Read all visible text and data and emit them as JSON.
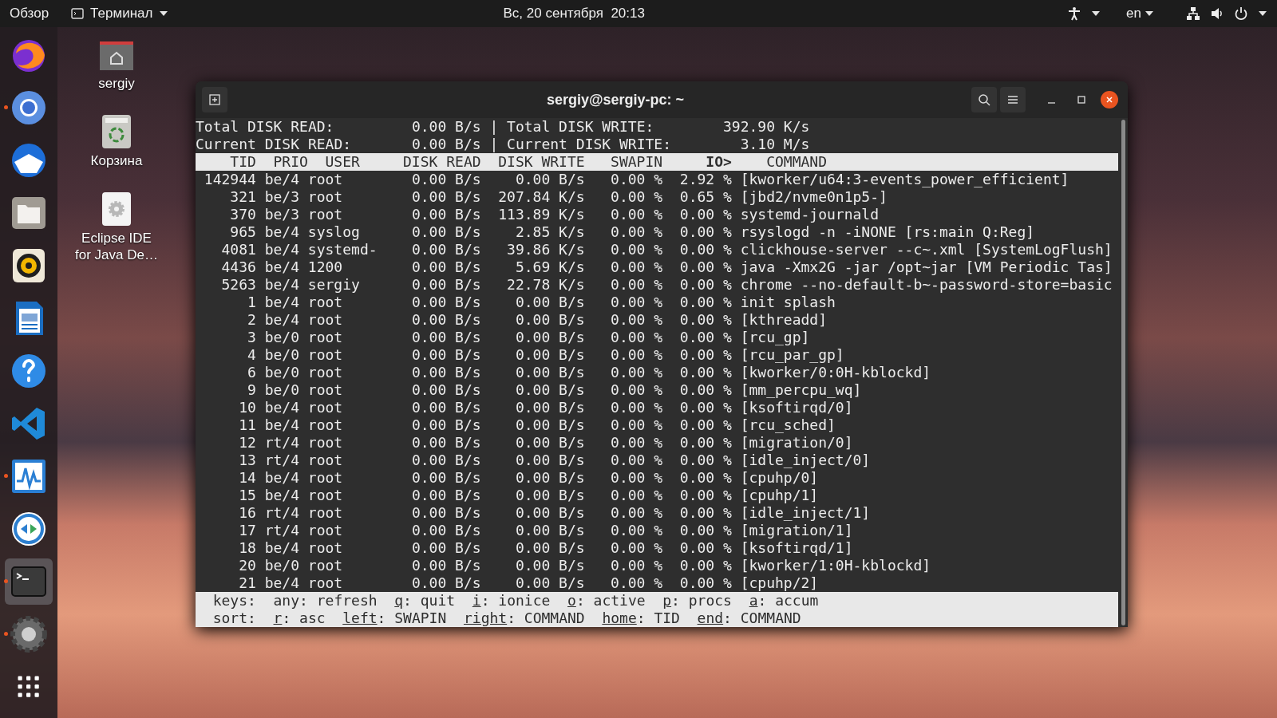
{
  "top_bar": {
    "overview": "Обзор",
    "app_menu": "Терминал",
    "clock": "Вс, 20 сентября  20:13",
    "language": "en"
  },
  "dock": [
    {
      "running": false,
      "active": false
    },
    {
      "running": true,
      "active": false
    },
    {
      "running": false,
      "active": false
    },
    {
      "running": false,
      "active": false
    },
    {
      "running": false,
      "active": false
    },
    {
      "running": false,
      "active": false
    },
    {
      "running": false,
      "active": false
    },
    {
      "running": false,
      "active": false
    },
    {
      "running": true,
      "active": false
    },
    {
      "running": false,
      "active": false
    },
    {
      "running": true,
      "active": true
    },
    {
      "running": true,
      "active": false
    },
    {
      "running": false,
      "active": false
    }
  ],
  "desktop_icons": [
    {
      "kind": "folder",
      "label": "sergiy"
    },
    {
      "kind": "trash",
      "label": "Корзина"
    },
    {
      "kind": "app",
      "label": "Eclipse IDE for Java De…"
    }
  ],
  "terminal": {
    "title": "sergiy@sergiy-pc: ~",
    "summary": [
      {
        "label": "Total DISK READ:",
        "value": "0.00 B/s",
        "separator": "|",
        "label2": "Total DISK WRITE:",
        "value2": "392.90 K/s"
      },
      {
        "label": "Current DISK READ:",
        "value": "0.00 B/s",
        "separator": "|",
        "label2": "Current DISK WRITE:",
        "value2": "3.10 M/s"
      }
    ],
    "columns": [
      {
        "label": "TID",
        "sorted": false
      },
      {
        "label": "PRIO",
        "sorted": false
      },
      {
        "label": "USER",
        "sorted": false
      },
      {
        "label": "DISK READ",
        "sorted": false
      },
      {
        "label": "DISK WRITE",
        "sorted": false
      },
      {
        "label": "SWAPIN",
        "sorted": false
      },
      {
        "label": "IO>",
        "sorted": true
      },
      {
        "label": "COMMAND",
        "sorted": false
      }
    ],
    "rows": [
      [
        "142944",
        "be/4",
        "root",
        "0.00 B/s",
        "0.00 B/s",
        "0.00 %",
        "2.92 %",
        "[kworker/u64:3-events_power_efficient]"
      ],
      [
        "321",
        "be/3",
        "root",
        "0.00 B/s",
        "207.84 K/s",
        "0.00 %",
        "0.65 %",
        "[jbd2/nvme0n1p5-]"
      ],
      [
        "370",
        "be/3",
        "root",
        "0.00 B/s",
        "113.89 K/s",
        "0.00 %",
        "0.00 %",
        "systemd-journald"
      ],
      [
        "965",
        "be/4",
        "syslog",
        "0.00 B/s",
        "2.85 K/s",
        "0.00 %",
        "0.00 %",
        "rsyslogd -n -iNONE [rs:main Q:Reg]"
      ],
      [
        "4081",
        "be/4",
        "systemd-",
        "0.00 B/s",
        "39.86 K/s",
        "0.00 %",
        "0.00 %",
        "clickhouse-server --c~.xml [SystemLogFlush]"
      ],
      [
        "4436",
        "be/4",
        "1200",
        "0.00 B/s",
        "5.69 K/s",
        "0.00 %",
        "0.00 %",
        "java -Xmx2G -jar /opt~jar [VM Periodic Tas]"
      ],
      [
        "5263",
        "be/4",
        "sergiy",
        "0.00 B/s",
        "22.78 K/s",
        "0.00 %",
        "0.00 %",
        "chrome --no-default-b~-password-store=basic"
      ],
      [
        "1",
        "be/4",
        "root",
        "0.00 B/s",
        "0.00 B/s",
        "0.00 %",
        "0.00 %",
        "init splash"
      ],
      [
        "2",
        "be/4",
        "root",
        "0.00 B/s",
        "0.00 B/s",
        "0.00 %",
        "0.00 %",
        "[kthreadd]"
      ],
      [
        "3",
        "be/0",
        "root",
        "0.00 B/s",
        "0.00 B/s",
        "0.00 %",
        "0.00 %",
        "[rcu_gp]"
      ],
      [
        "4",
        "be/0",
        "root",
        "0.00 B/s",
        "0.00 B/s",
        "0.00 %",
        "0.00 %",
        "[rcu_par_gp]"
      ],
      [
        "6",
        "be/0",
        "root",
        "0.00 B/s",
        "0.00 B/s",
        "0.00 %",
        "0.00 %",
        "[kworker/0:0H-kblockd]"
      ],
      [
        "9",
        "be/0",
        "root",
        "0.00 B/s",
        "0.00 B/s",
        "0.00 %",
        "0.00 %",
        "[mm_percpu_wq]"
      ],
      [
        "10",
        "be/4",
        "root",
        "0.00 B/s",
        "0.00 B/s",
        "0.00 %",
        "0.00 %",
        "[ksoftirqd/0]"
      ],
      [
        "11",
        "be/4",
        "root",
        "0.00 B/s",
        "0.00 B/s",
        "0.00 %",
        "0.00 %",
        "[rcu_sched]"
      ],
      [
        "12",
        "rt/4",
        "root",
        "0.00 B/s",
        "0.00 B/s",
        "0.00 %",
        "0.00 %",
        "[migration/0]"
      ],
      [
        "13",
        "rt/4",
        "root",
        "0.00 B/s",
        "0.00 B/s",
        "0.00 %",
        "0.00 %",
        "[idle_inject/0]"
      ],
      [
        "14",
        "be/4",
        "root",
        "0.00 B/s",
        "0.00 B/s",
        "0.00 %",
        "0.00 %",
        "[cpuhp/0]"
      ],
      [
        "15",
        "be/4",
        "root",
        "0.00 B/s",
        "0.00 B/s",
        "0.00 %",
        "0.00 %",
        "[cpuhp/1]"
      ],
      [
        "16",
        "rt/4",
        "root",
        "0.00 B/s",
        "0.00 B/s",
        "0.00 %",
        "0.00 %",
        "[idle_inject/1]"
      ],
      [
        "17",
        "rt/4",
        "root",
        "0.00 B/s",
        "0.00 B/s",
        "0.00 %",
        "0.00 %",
        "[migration/1]"
      ],
      [
        "18",
        "be/4",
        "root",
        "0.00 B/s",
        "0.00 B/s",
        "0.00 %",
        "0.00 %",
        "[ksoftirqd/1]"
      ],
      [
        "20",
        "be/0",
        "root",
        "0.00 B/s",
        "0.00 B/s",
        "0.00 %",
        "0.00 %",
        "[kworker/1:0H-kblockd]"
      ],
      [
        "21",
        "be/4",
        "root",
        "0.00 B/s",
        "0.00 B/s",
        "0.00 %",
        "0.00 %",
        "[cpuhp/2]"
      ]
    ],
    "key_lines": [
      {
        "label": "keys:",
        "items": [
          {
            "key": "any",
            "text": ": refresh",
            "underlined": false
          },
          {
            "key": "q",
            "text": ": quit",
            "underlined": true
          },
          {
            "key": "i",
            "text": ": ionice",
            "underlined": true
          },
          {
            "key": "o",
            "text": ": active",
            "underlined": true
          },
          {
            "key": "p",
            "text": ": procs",
            "underlined": true
          },
          {
            "key": "a",
            "text": ": accum",
            "underlined": true
          }
        ]
      },
      {
        "label": "sort:",
        "items": [
          {
            "key": "r",
            "text": ": asc",
            "underlined": true
          },
          {
            "key": "left",
            "text": ": SWAPIN",
            "underlined": true
          },
          {
            "key": "right",
            "text": ": COMMAND",
            "underlined": true
          },
          {
            "key": "home",
            "text": ": TID",
            "underlined": true
          },
          {
            "key": "end",
            "text": ": COMMAND",
            "underlined": true
          }
        ]
      }
    ]
  }
}
